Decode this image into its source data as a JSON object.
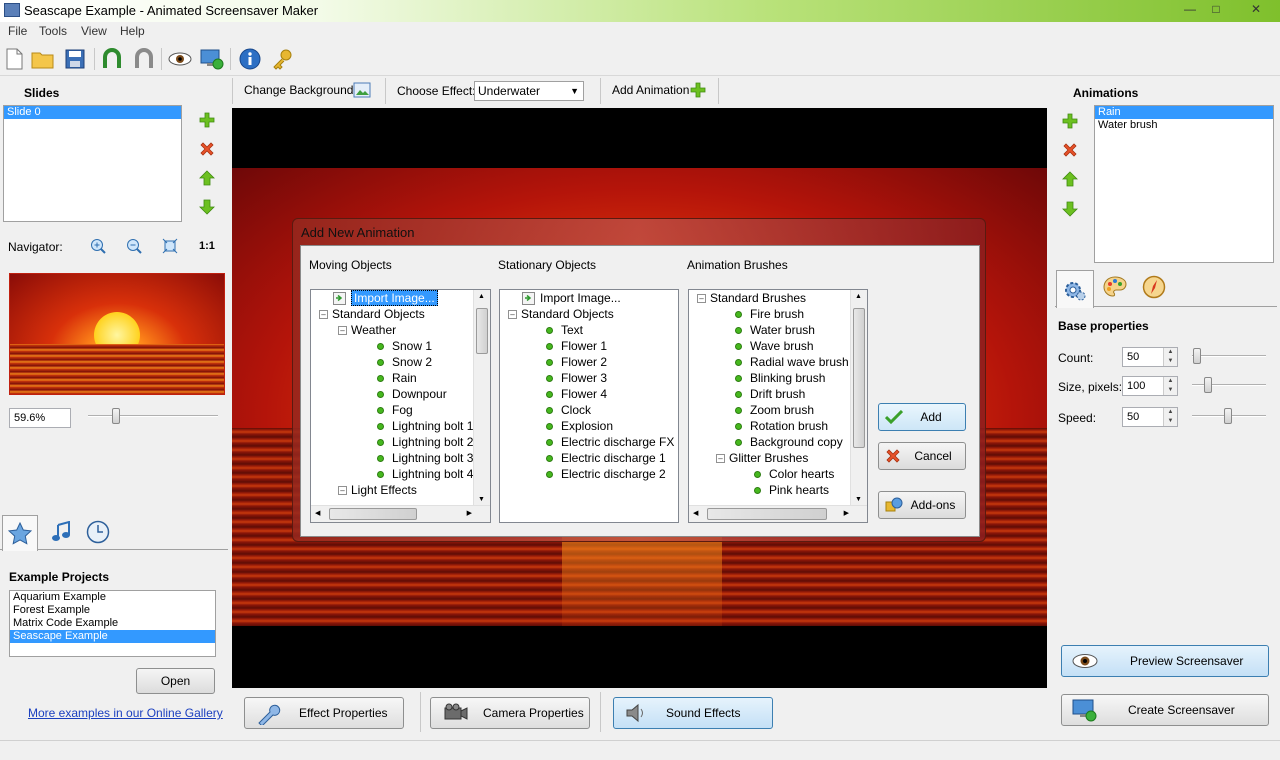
{
  "window": {
    "title": "Seascape Example - Animated Screensaver Maker"
  },
  "menu": [
    "File",
    "Tools",
    "View",
    "Help"
  ],
  "slides": {
    "label": "Slides",
    "items": [
      {
        "label": "Slide 0",
        "selected": true
      }
    ]
  },
  "navigator": {
    "label": "Navigator:",
    "actual_size": "1:1",
    "zoom_value": "59.6%"
  },
  "examples": {
    "label": "Example Projects",
    "items": [
      "Aquarium Example",
      "Forest Example",
      "Matrix Code Example",
      "Seascape Example"
    ],
    "selected": "Seascape Example",
    "open_label": "Open",
    "gallery_link": "More examples in our Online Gallery"
  },
  "main_toolbar": {
    "change_background": "Change Background",
    "choose_effect_label": "Choose Effect:",
    "effect_value": "Underwater",
    "add_animation": "Add Animation"
  },
  "dialog": {
    "title": "Add New Animation",
    "moving": {
      "header": "Moving Objects",
      "rows": [
        "Import Image...",
        "Standard Objects",
        "Weather",
        "Snow 1",
        "Snow 2",
        "Rain",
        "Downpour",
        "Fog",
        "Lightning bolt 1",
        "Lightning bolt 2",
        "Lightning bolt 3",
        "Lightning bolt 4",
        "Light Effects"
      ]
    },
    "stationary": {
      "header": "Stationary Objects",
      "rows": [
        "Import Image...",
        "Standard Objects",
        "Text",
        "Flower 1",
        "Flower 2",
        "Flower 3",
        "Flower 4",
        "Clock",
        "Explosion",
        "Electric discharge FX",
        "Electric discharge 1",
        "Electric discharge 2"
      ]
    },
    "brushes": {
      "header": "Animation Brushes",
      "rows": [
        "Standard Brushes",
        "Fire brush",
        "Water brush",
        "Wave brush",
        "Radial wave brush",
        "Blinking brush",
        "Drift brush",
        "Zoom brush",
        "Rotation brush",
        "Background copy",
        "Glitter Brushes",
        "Color hearts",
        "Pink hearts"
      ]
    },
    "add_label": "Add",
    "cancel_label": "Cancel",
    "addons_label": "Add-ons"
  },
  "animations": {
    "label": "Animations",
    "items": [
      {
        "label": "Rain",
        "selected": true
      },
      {
        "label": "Water brush",
        "selected": false
      }
    ]
  },
  "properties": {
    "section": "Base properties",
    "count_label": "Count:",
    "count_value": "50",
    "count_level": 0.02,
    "size_label": "Size, pixels:",
    "size_value": "100",
    "size_level": 0.18,
    "speed_label": "Speed:",
    "speed_value": "50",
    "speed_level": 0.48
  },
  "bottom": {
    "effect_properties": "Effect Properties",
    "camera_properties": "Camera Properties",
    "sound_effects": "Sound Effects",
    "preview": "Preview Screensaver",
    "create": "Create Screensaver"
  },
  "colors": {
    "accent_blue": "#3399ff",
    "dot_green": "#46b81e",
    "add_green": "#6cc020",
    "delete_orange": "#e8522a"
  }
}
